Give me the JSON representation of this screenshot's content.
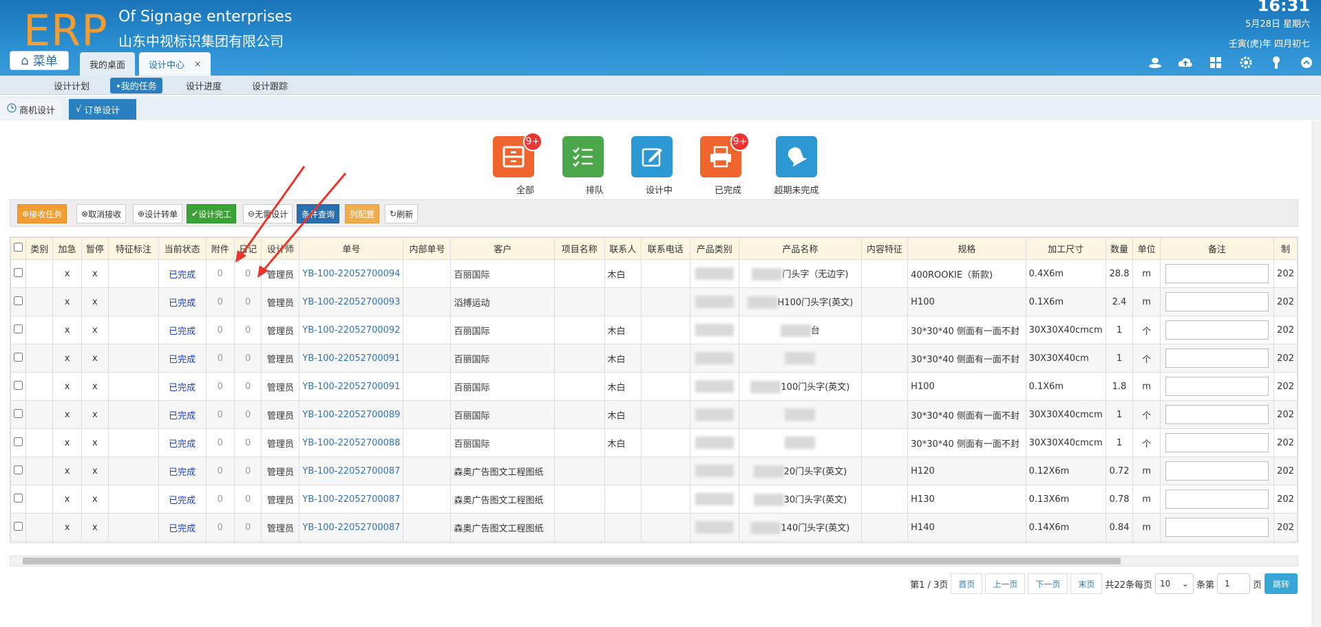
{
  "header": {
    "logo": "ERP",
    "company_en": "Of Signage enterprises",
    "company_cn": "山东中视标识集团有限公司",
    "time": "16:31",
    "date": "5月28日 星期六",
    "lunar": "壬寅(虎)年 四月初七",
    "menu_label": "菜单",
    "tabs": [
      {
        "label": "我的桌面"
      },
      {
        "label": "设计中心",
        "close": "×"
      }
    ],
    "icons": [
      "user-icon",
      "cloud-upload-icon",
      "dashboard-icon",
      "gear-icon",
      "key-icon",
      "collapse-up-icon"
    ]
  },
  "subnav": [
    "设计计划",
    "•我的任务",
    "设计进度",
    "设计跟踪"
  ],
  "tabs2": [
    "商机设计",
    "订单设计"
  ],
  "big_icons": [
    {
      "label": "全部",
      "badge": "9+",
      "color": "#f0642e"
    },
    {
      "label": "排队",
      "badge": "",
      "color": "#4aa84a"
    },
    {
      "label": "设计中",
      "badge": "",
      "color": "#2c98d4"
    },
    {
      "label": "已完成",
      "badge": "9+",
      "color": "#f0642e"
    },
    {
      "label": "超期未完成",
      "badge": "",
      "color": "#2c98d4"
    }
  ],
  "toolbar": [
    {
      "label": "接收任务",
      "icon": "⊕"
    },
    {
      "label": "取消接收",
      "icon": "⊗"
    },
    {
      "label": "设计转单",
      "icon": "⊕"
    },
    {
      "label": "设计完工",
      "icon": "✔"
    },
    {
      "label": "无需设计",
      "icon": "⊖"
    },
    {
      "label": "条件查询",
      "icon": ""
    },
    {
      "label": "列配置",
      "icon": ""
    },
    {
      "label": "刷新",
      "icon": "↻"
    }
  ],
  "table": {
    "headers": [
      "类别",
      "加急",
      "暂停",
      "特征标注",
      "当前状态",
      "附件",
      "日记",
      "设计师",
      "单号",
      "内部单号",
      "客户",
      "项目名称",
      "联系人",
      "联系电话",
      "产品类别",
      "产品名称",
      "内容特征",
      "规格",
      "加工尺寸",
      "数量",
      "单位",
      "备注",
      "制"
    ],
    "rows": [
      {
        "urgent": "x",
        "pause": "x",
        "status": "已完成",
        "attach": "0",
        "diary": "0",
        "designer": "管理员",
        "order": "YB-100-22052700094",
        "customer": "百丽国际",
        "contact": "木白",
        "product_name": "门头字（无边字)",
        "spec": "400ROOKIE（新款)",
        "size": "0.4X6m",
        "qty": "28.8",
        "unit": "m",
        "made": "202"
      },
      {
        "urgent": "x",
        "pause": "x",
        "status": "已完成",
        "attach": "0",
        "diary": "0",
        "designer": "管理员",
        "order": "YB-100-22052700093",
        "customer": "滔搏运动",
        "contact": "",
        "product_name": "H100门头字(英文)",
        "spec": "H100",
        "size": "0.1X6m",
        "qty": "2.4",
        "unit": "m",
        "made": "202"
      },
      {
        "urgent": "x",
        "pause": "x",
        "status": "已完成",
        "attach": "0",
        "diary": "0",
        "designer": "管理员",
        "order": "YB-100-22052700092",
        "customer": "百丽国际",
        "contact": "木白",
        "product_name": "台",
        "spec": "30*30*40 侧面有一面不封",
        "size": "30X30X40cmcm",
        "qty": "1",
        "unit": "个",
        "made": "202"
      },
      {
        "urgent": "x",
        "pause": "x",
        "status": "已完成",
        "attach": "0",
        "diary": "0",
        "designer": "管理员",
        "order": "YB-100-22052700091",
        "customer": "百丽国际",
        "contact": "木白",
        "product_name": "",
        "spec": "30*30*40 侧面有一面不封",
        "size": "30X30X40cm",
        "qty": "1",
        "unit": "个",
        "made": "202"
      },
      {
        "urgent": "x",
        "pause": "x",
        "status": "已完成",
        "attach": "0",
        "diary": "0",
        "designer": "管理员",
        "order": "YB-100-22052700091",
        "customer": "百丽国际",
        "contact": "木白",
        "product_name": "100门头字(英文)",
        "spec": "H100",
        "size": "0.1X6m",
        "qty": "1.8",
        "unit": "m",
        "made": "202"
      },
      {
        "urgent": "x",
        "pause": "x",
        "status": "已完成",
        "attach": "0",
        "diary": "0",
        "designer": "管理员",
        "order": "YB-100-22052700089",
        "customer": "百丽国际",
        "contact": "木白",
        "product_name": "",
        "spec": "30*30*40 侧面有一面不封",
        "size": "30X30X40cmcm",
        "qty": "1",
        "unit": "个",
        "made": "202"
      },
      {
        "urgent": "x",
        "pause": "x",
        "status": "已完成",
        "attach": "0",
        "diary": "0",
        "designer": "管理员",
        "order": "YB-100-22052700088",
        "customer": "百丽国际",
        "contact": "木白",
        "product_name": "",
        "spec": "30*30*40 侧面有一面不封",
        "size": "30X30X40cmcm",
        "qty": "1",
        "unit": "个",
        "made": "202"
      },
      {
        "urgent": "x",
        "pause": "x",
        "status": "已完成",
        "attach": "0",
        "diary": "0",
        "designer": "管理员",
        "order": "YB-100-22052700087",
        "customer": "森奥广告图文工程图纸",
        "contact": "",
        "product_name": "20门头字(英文)",
        "spec": "H120",
        "size": "0.12X6m",
        "qty": "0.72",
        "unit": "m",
        "made": "202"
      },
      {
        "urgent": "x",
        "pause": "x",
        "status": "已完成",
        "attach": "0",
        "diary": "0",
        "designer": "管理员",
        "order": "YB-100-22052700087",
        "customer": "森奥广告图文工程图纸",
        "contact": "",
        "product_name": "30门头字(英文)",
        "spec": "H130",
        "size": "0.13X6m",
        "qty": "0.78",
        "unit": "m",
        "made": "202"
      },
      {
        "urgent": "x",
        "pause": "x",
        "status": "已完成",
        "attach": "0",
        "diary": "0",
        "designer": "管理员",
        "order": "YB-100-22052700087",
        "customer": "森奥广告图文工程图纸",
        "contact": "",
        "product_name": "140门头字(英文)",
        "spec": "H140",
        "size": "0.14X6m",
        "qty": "0.84",
        "unit": "m",
        "made": "202"
      }
    ]
  },
  "pager": {
    "page_info": "第1 / 3页",
    "first": "首页",
    "prev": "上一页",
    "next": "下一页",
    "last": "末页",
    "total": "共22条每页",
    "per_page": "10",
    "per_page_suffix": "条第",
    "page_input": "1",
    "page_suffix": "页",
    "go": "跳转"
  }
}
